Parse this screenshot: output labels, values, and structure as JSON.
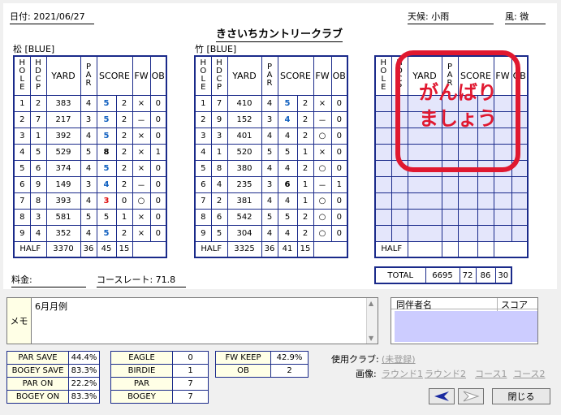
{
  "header": {
    "date": "日付: 2021/06/27",
    "weather": "天候: 小雨",
    "wind": "風: 微",
    "club_name": "きさいちカントリークラブ",
    "fee": "料金:",
    "course_rate": "コースレート:  71.8"
  },
  "front": {
    "course_label": "松 [BLUE]",
    "columns": {
      "yard": "YARD",
      "score": "SCORE",
      "fw": "FW",
      "ob": "OB"
    },
    "holes": [
      {
        "hole": "1",
        "hdcp": "2",
        "yard": "383",
        "par": "4",
        "score": "5",
        "putts": "2",
        "fw": "×",
        "ob": "0",
        "color": "blue"
      },
      {
        "hole": "2",
        "hdcp": "7",
        "yard": "217",
        "par": "3",
        "score": "5",
        "putts": "2",
        "fw": "－",
        "ob": "0",
        "color": "blue"
      },
      {
        "hole": "3",
        "hdcp": "1",
        "yard": "392",
        "par": "4",
        "score": "5",
        "putts": "2",
        "fw": "×",
        "ob": "0",
        "color": "blue"
      },
      {
        "hole": "4",
        "hdcp": "5",
        "yard": "529",
        "par": "5",
        "score": "8",
        "putts": "2",
        "fw": "×",
        "ob": "1",
        "color": "black"
      },
      {
        "hole": "5",
        "hdcp": "6",
        "yard": "374",
        "par": "4",
        "score": "5",
        "putts": "2",
        "fw": "×",
        "ob": "0",
        "color": "blue"
      },
      {
        "hole": "6",
        "hdcp": "9",
        "yard": "149",
        "par": "3",
        "score": "4",
        "putts": "2",
        "fw": "－",
        "ob": "0",
        "color": "blue"
      },
      {
        "hole": "7",
        "hdcp": "8",
        "yard": "393",
        "par": "4",
        "score": "3",
        "putts": "0",
        "fw": "○",
        "ob": "0",
        "color": "red"
      },
      {
        "hole": "8",
        "hdcp": "3",
        "yard": "581",
        "par": "5",
        "score": "5",
        "putts": "1",
        "fw": "×",
        "ob": "0",
        "color": "plain"
      },
      {
        "hole": "9",
        "hdcp": "4",
        "yard": "352",
        "par": "4",
        "score": "5",
        "putts": "2",
        "fw": "×",
        "ob": "0",
        "color": "blue"
      }
    ],
    "half": {
      "label": "HALF",
      "yard": "3370",
      "par": "36",
      "score": "45",
      "putts": "15"
    }
  },
  "back": {
    "course_label": "竹 [BLUE]",
    "columns": {
      "yard": "YARD",
      "score": "SCORE",
      "fw": "FW",
      "ob": "OB"
    },
    "holes": [
      {
        "hole": "1",
        "hdcp": "7",
        "yard": "410",
        "par": "4",
        "score": "5",
        "putts": "2",
        "fw": "×",
        "ob": "0",
        "color": "blue"
      },
      {
        "hole": "2",
        "hdcp": "9",
        "yard": "152",
        "par": "3",
        "score": "4",
        "putts": "2",
        "fw": "－",
        "ob": "0",
        "color": "blue"
      },
      {
        "hole": "3",
        "hdcp": "3",
        "yard": "401",
        "par": "4",
        "score": "4",
        "putts": "2",
        "fw": "○",
        "ob": "0",
        "color": "plain"
      },
      {
        "hole": "4",
        "hdcp": "1",
        "yard": "520",
        "par": "5",
        "score": "5",
        "putts": "1",
        "fw": "×",
        "ob": "0",
        "color": "plain"
      },
      {
        "hole": "5",
        "hdcp": "8",
        "yard": "380",
        "par": "4",
        "score": "4",
        "putts": "2",
        "fw": "○",
        "ob": "0",
        "color": "plain"
      },
      {
        "hole": "6",
        "hdcp": "4",
        "yard": "235",
        "par": "3",
        "score": "6",
        "putts": "1",
        "fw": "－",
        "ob": "1",
        "color": "black"
      },
      {
        "hole": "7",
        "hdcp": "2",
        "yard": "381",
        "par": "4",
        "score": "4",
        "putts": "1",
        "fw": "○",
        "ob": "0",
        "color": "plain"
      },
      {
        "hole": "8",
        "hdcp": "6",
        "yard": "542",
        "par": "5",
        "score": "5",
        "putts": "2",
        "fw": "○",
        "ob": "0",
        "color": "plain"
      },
      {
        "hole": "9",
        "hdcp": "5",
        "yard": "304",
        "par": "4",
        "score": "4",
        "putts": "2",
        "fw": "○",
        "ob": "0",
        "color": "plain"
      }
    ],
    "half": {
      "label": "HALF",
      "yard": "3325",
      "par": "36",
      "score": "41",
      "putts": "15"
    }
  },
  "third": {
    "columns": {
      "yard": "YARD",
      "score": "SCORE",
      "fw": "FW",
      "ob": "OB"
    },
    "half": {
      "label": "HALF"
    },
    "total": {
      "label": "TOTAL",
      "yard": "6695",
      "par": "72",
      "score": "86",
      "putts": "30"
    },
    "stamp_line1": "がんばり",
    "stamp_line2": "ましょう"
  },
  "memo": {
    "label": "メモ",
    "text": "6月月例"
  },
  "companions": {
    "name_header": "同伴者名",
    "score_header": "スコア"
  },
  "stats1": [
    {
      "label": "PAR SAVE",
      "value": "44.4%"
    },
    {
      "label": "BOGEY SAVE",
      "value": "83.3%"
    },
    {
      "label": "PAR ON",
      "value": "22.2%"
    },
    {
      "label": "BOGEY ON",
      "value": "83.3%"
    }
  ],
  "stats2": [
    {
      "label": "EAGLE",
      "value": "0"
    },
    {
      "label": "BIRDIE",
      "value": "1"
    },
    {
      "label": "PAR",
      "value": "7"
    },
    {
      "label": "BOGEY",
      "value": "7"
    }
  ],
  "stats3": [
    {
      "label": "FW KEEP",
      "value": "42.9%"
    },
    {
      "label": "OB",
      "value": "2"
    }
  ],
  "footer": {
    "clubs_label": "使用クラブ:",
    "clubs_value": "(未登録)",
    "images_label": "画像:",
    "round1": "ラウンド1",
    "round2": "ラウンド2",
    "course1": "コース1",
    "course2": "コース2",
    "close": "閉じる"
  },
  "colors": {
    "grid": "#1a2a8a",
    "stamp": "#e01830",
    "blue_score": "#1060c0",
    "red_score": "#e01010"
  }
}
